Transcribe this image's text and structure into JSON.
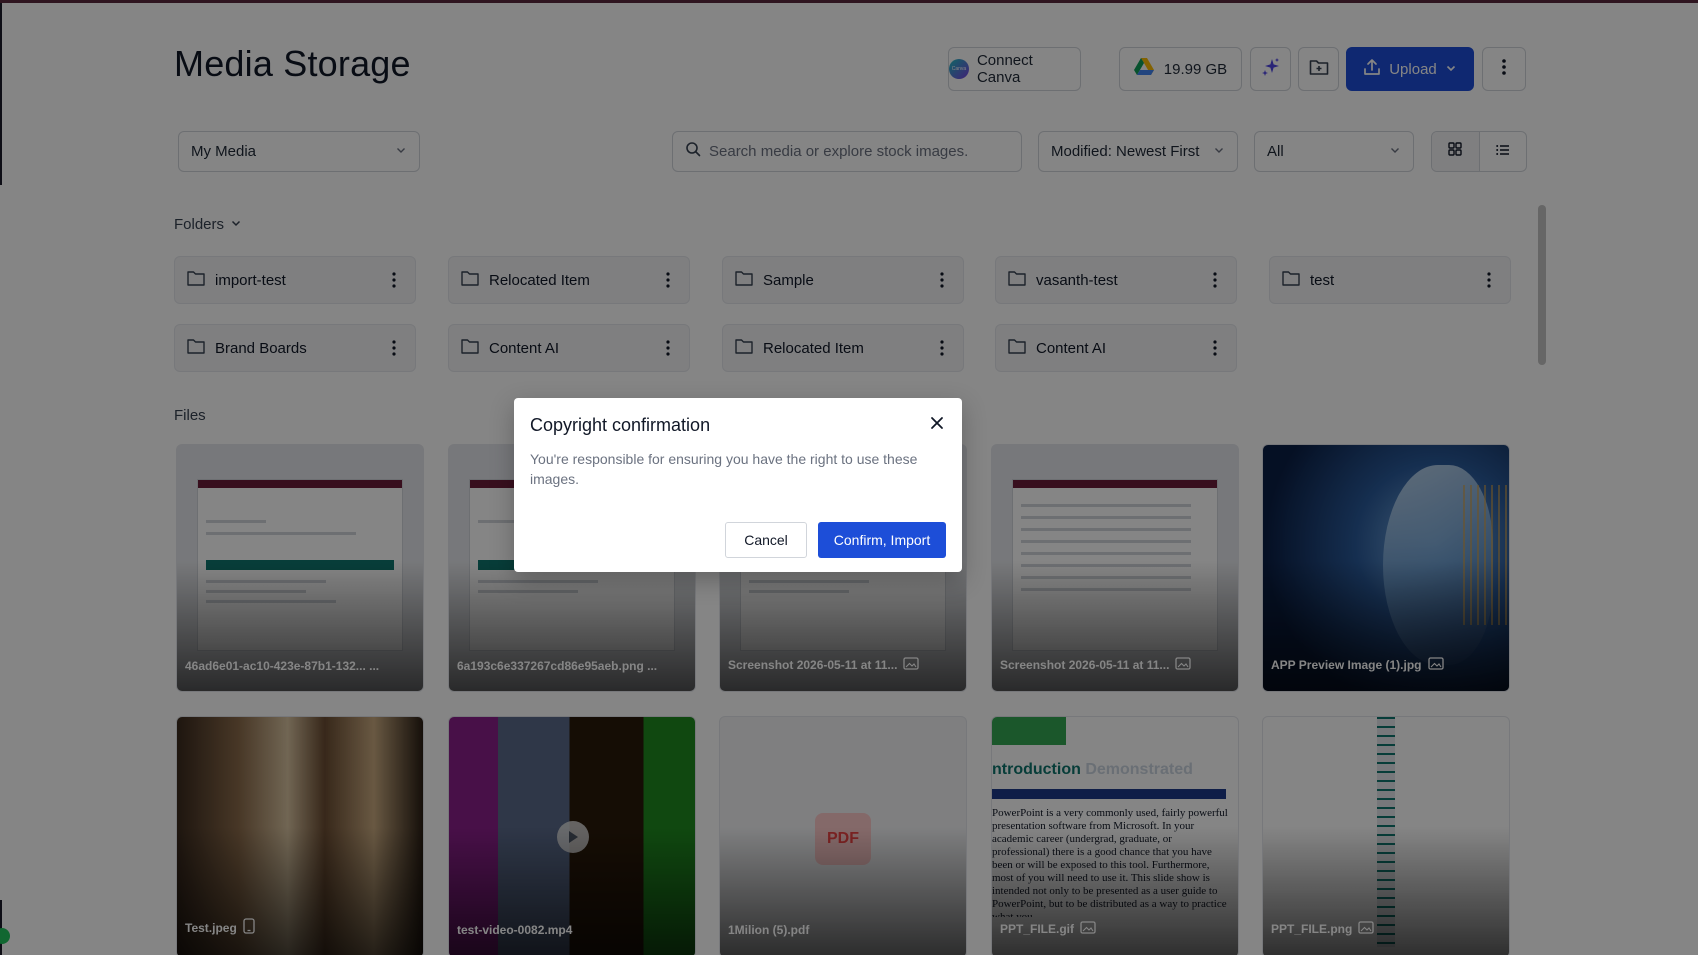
{
  "page": {
    "title": "Media Storage"
  },
  "header": {
    "connect_canva": "Connect Canva",
    "canva_logo_text": "Canva",
    "storage": "19.99 GB",
    "upload": "Upload"
  },
  "filters": {
    "source": "My Media",
    "search_placeholder": "Search media or explore stock images.",
    "sort": "Modified: Newest First",
    "type": "All"
  },
  "sections": {
    "folders": "Folders",
    "files": "Files"
  },
  "folders": [
    {
      "name": "import-test"
    },
    {
      "name": "Relocated Item"
    },
    {
      "name": "Sample"
    },
    {
      "name": "vasanth-test"
    },
    {
      "name": "test"
    },
    {
      "name": "Brand Boards"
    },
    {
      "name": "Content AI"
    },
    {
      "name": "Relocated Item"
    },
    {
      "name": "Content AI"
    }
  ],
  "files": [
    {
      "name": "46ad6e01-ac10-423e-87b1-132... ..."
    },
    {
      "name": "6a193c6e337267cd86e95aeb.png ..."
    },
    {
      "name": "Screenshot 2026-05-11 at 11..."
    },
    {
      "name": "Screenshot 2026-05-11 at 11..."
    },
    {
      "name": "APP Preview Image (1).jpg"
    },
    {
      "name": "Test.jpeg"
    },
    {
      "name": "test-video-0082.mp4"
    },
    {
      "name": "1Milion (5).pdf"
    },
    {
      "name": "PPT_FILE.gif"
    },
    {
      "name": "PPT_FILE.png"
    }
  ],
  "thumbnails": {
    "pdf_badge": "PDF",
    "ppt_title_a": "ntroduction",
    "ppt_title_b": "Demonstrated",
    "ppt_body": "PowerPoint is a very commonly used, fairly powerful presentation software from Microsoft. In your academic career (undergrad, graduate, or professional) there is a good chance that you have been or will be exposed to this tool. Furthermore, most of you will need to use it. This slide show is intended not only to be presented as a user guide to PowerPoint, but to be distributed as a way to practice what you"
  },
  "modal": {
    "title": "Copyright confirmation",
    "body": "You're responsible for ensuring you have the right to use these images.",
    "cancel": "Cancel",
    "confirm": "Confirm, Import"
  },
  "colors": {
    "primary": "#1d4ed8",
    "accent_bar": "#5b2a3f",
    "overlay": "rgba(0,0,0,0.48)"
  },
  "icons": [
    "canva-logo-icon",
    "google-drive-icon",
    "sparkle-icon",
    "new-folder-icon",
    "upload-icon",
    "chevron-down-icon",
    "more-vertical-icon",
    "search-icon",
    "grid-view-icon",
    "list-view-icon",
    "folder-icon",
    "image-icon",
    "phone-icon",
    "play-icon",
    "close-icon"
  ]
}
